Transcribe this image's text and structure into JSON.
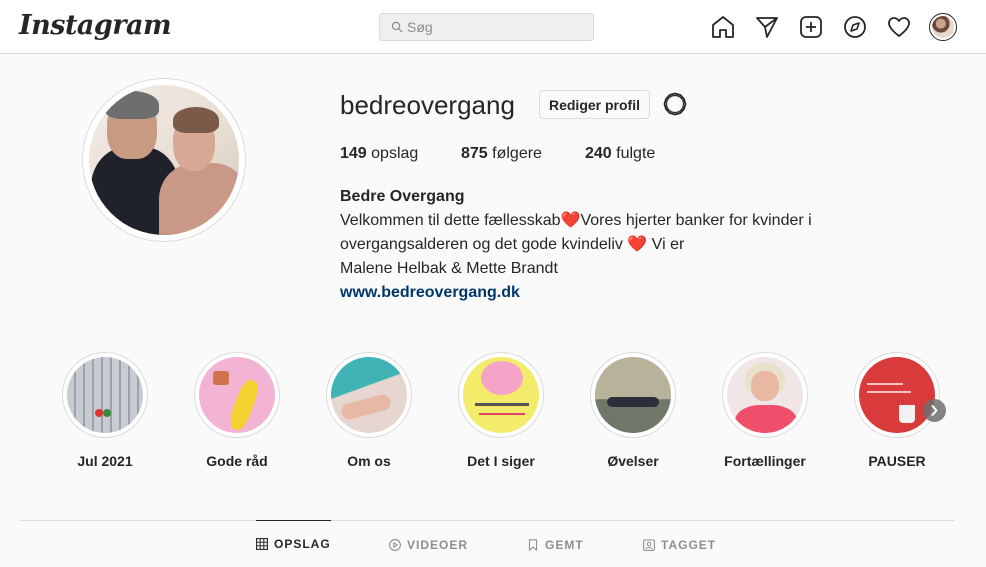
{
  "nav": {
    "logo": "Instagram",
    "search_placeholder": "Søg",
    "icons": [
      "home-icon",
      "direct-icon",
      "new-post-icon",
      "explore-icon",
      "activity-icon",
      "profile-avatar"
    ]
  },
  "profile": {
    "username": "bedreovergang",
    "edit_button": "Rediger profil",
    "stats": {
      "posts_count": "149",
      "posts_label": "opslag",
      "followers_count": "875",
      "followers_label": "følgere",
      "following_count": "240",
      "following_label": "fulgte"
    },
    "bio": {
      "name": "Bedre Overgang",
      "line1": "Velkommen til dette fællesskab❤️Vores hjerter banker for kvinder i",
      "line2": "overgangsalderen og det gode kvindeliv ❤️ Vi er",
      "line3": "Malene Helbak & Mette Brandt",
      "link": "www.bedreovergang.dk"
    }
  },
  "highlights": [
    {
      "label": "Jul 2021"
    },
    {
      "label": "Gode råd"
    },
    {
      "label": "Om os"
    },
    {
      "label": "Det I siger"
    },
    {
      "label": "Øvelser"
    },
    {
      "label": "Fortællinger"
    },
    {
      "label": "PAUSER"
    }
  ],
  "tabs": [
    {
      "label": "OPSLAG",
      "active": true
    },
    {
      "label": "VIDEOER",
      "active": false
    },
    {
      "label": "GEMT",
      "active": false
    },
    {
      "label": "TAGGET",
      "active": false
    }
  ],
  "colors": {
    "link": "#00376b",
    "border": "#dbdbdb",
    "text": "#262626",
    "muted": "#8e8e8e"
  }
}
